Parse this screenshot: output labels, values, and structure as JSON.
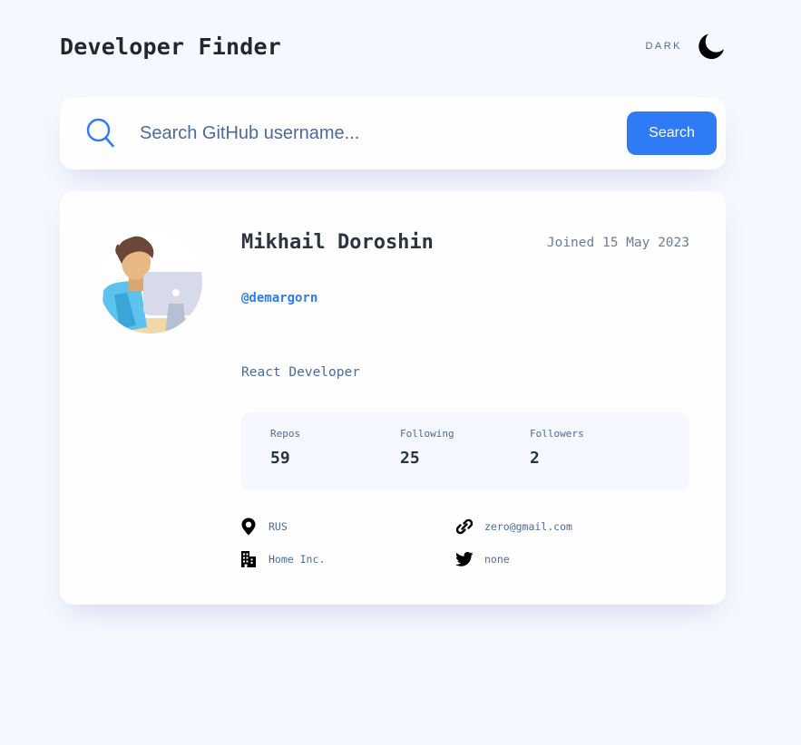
{
  "header": {
    "title": "Developer Finder",
    "theme_label": "DARK",
    "theme_icon": "moon-icon"
  },
  "search": {
    "placeholder": "Search GitHub username...",
    "value": "",
    "button_label": "Search",
    "icon": "search-icon"
  },
  "profile": {
    "name": "Mikhail Doroshin",
    "joined": "Joined 15 May 2023",
    "login": "@demargorn",
    "bio": "React Developer",
    "stats": [
      {
        "label": "Repos",
        "value": "59"
      },
      {
        "label": "Following",
        "value": "25"
      },
      {
        "label": "Followers",
        "value": "2"
      }
    ],
    "info": {
      "location": {
        "icon": "location-pin-icon",
        "text": "RUS"
      },
      "website": {
        "icon": "link-icon",
        "text": "zero@gmail.com"
      },
      "company": {
        "icon": "building-icon",
        "text": "Home Inc."
      },
      "twitter": {
        "icon": "twitter-icon",
        "text": "none"
      }
    }
  },
  "colors": {
    "background": "#f5f8ff",
    "card": "#fefefe",
    "accent": "#2f7bf5",
    "text_dark": "#2b3442",
    "text_muted": "#4b6a9b",
    "stats_bg": "#f6f8ff"
  }
}
